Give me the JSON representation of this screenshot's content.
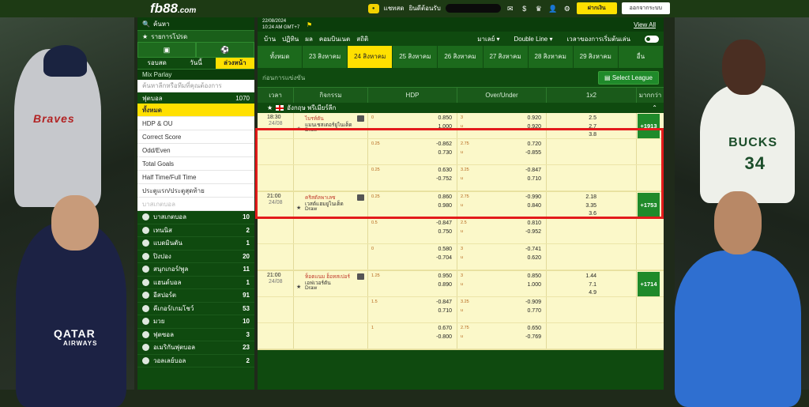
{
  "header": {
    "logo_main": "fb88",
    "logo_suffix": ".com",
    "chat_label": "แชทสด",
    "balance_label": "ยินดีต้อนรับ",
    "deposit_label": "ฝากเงิน",
    "logout_label": "ออกจากระบบ"
  },
  "background_text": {
    "braves": "Braves",
    "bucks": "BUCKS",
    "bucks_number": "34",
    "qatar": "QATAR",
    "airways": "AIRWAYS"
  },
  "sidebar": {
    "search_label": "ค้นหา",
    "list_title": "รายการโปรด",
    "day_tabs": [
      "รอบสด",
      "วันนี้",
      "ล่วงหน้า"
    ],
    "mix_parlay": "Mix Parlay",
    "search_placeholder": "ค้นหาลีกหรือทีมที่คุณต้องการ",
    "football_label": "ฟุตบอล",
    "football_count": "1070",
    "bet_types": [
      "ทั้งหมด",
      "HDP & OU",
      "Correct Score",
      "Odd/Even",
      "Total Goals",
      "Half Time/Full Time",
      "ประตูแรก/ประตูสุดท้าย",
      "บาสเกตบอล"
    ],
    "sports": [
      {
        "name": "บาสเกตบอล",
        "count": "10"
      },
      {
        "name": "เทนนิส",
        "count": "2"
      },
      {
        "name": "แบดมินตัน",
        "count": "1"
      },
      {
        "name": "ปิงปอง",
        "count": "20"
      },
      {
        "name": "สนุกเกอร์/พูล",
        "count": "11"
      },
      {
        "name": "แฮนด์บอล",
        "count": "1"
      },
      {
        "name": "อีสปอร์ต",
        "count": "91"
      },
      {
        "name": "คีเกอร์/เกมโชว์",
        "count": "53"
      },
      {
        "name": "มวย",
        "count": "10"
      },
      {
        "name": "ฟุตซอล",
        "count": "3"
      },
      {
        "name": "อเมริกันฟุตบอล",
        "count": "23"
      },
      {
        "name": "วอลเลย์บอล",
        "count": "2"
      }
    ]
  },
  "main": {
    "date_line1": "22/08/2024",
    "date_line2": "10:24 AM GMT+7",
    "view_all": "View All",
    "filters": [
      "บ้าน",
      "ปฏิทิน",
      "ผล",
      "คอมบินเนต",
      "สถิติ"
    ],
    "market_select": "มาเลย์",
    "line_select": "Double Line",
    "sort_label": "เวลาของการเริ่มต้นเล่น",
    "date_tabs": [
      "ทั้งหมด",
      "23 สิงหาคม",
      "24 สิงหาคม",
      "25 สิงหาคม",
      "26 สิงหาคม",
      "27 สิงหาคม",
      "28 สิงหาคม",
      "29 สิงหาคม",
      "อื่น"
    ],
    "league_filter_label": "ก่อนการแข่งขัน",
    "select_league": "Select League",
    "columns": [
      "เวลา",
      "กิจกรรม",
      "HDP",
      "Over/Under",
      "1x2",
      "มากกว่า"
    ],
    "league_name": "อังกฤษ พรีเมียร์ลีก"
  },
  "matches": [
    {
      "time": "18:30",
      "date": "24/08",
      "home": "ไบรท์ตัน",
      "away": "แมนเชสเตอร์ยูไนเต็ด",
      "draw": "Draw",
      "rows": [
        {
          "hdp_line": "0",
          "hdp_home": "0.850",
          "hdp_away": "1.000",
          "ou_line": "3",
          "ou_over": "0.920",
          "ou_under": "0.920",
          "x1": "2.5",
          "x2": "2.7",
          "x3": "3.8"
        },
        {
          "hdp_line": "0.25",
          "hdp_home": "-0.862",
          "hdp_away": "0.730",
          "ou_line": "2.75",
          "ou_over": "0.720",
          "ou_under": "-0.855",
          "x1": "",
          "x2": "",
          "x3": ""
        },
        {
          "hdp_line": "0.25",
          "hdp_home": "0.630",
          "hdp_away": "-0.752",
          "ou_line": "3.25",
          "ou_over": "-0.847",
          "ou_under": "0.710",
          "x1": "",
          "x2": "",
          "x3": ""
        }
      ],
      "more": "+1913"
    },
    {
      "time": "21:00",
      "date": "24/08",
      "home": "คริสตัลพาเลซ",
      "away": "เวสต์แฮมยูไนเต็ด",
      "draw": "Draw",
      "rows": [
        {
          "hdp_line": "0.25",
          "hdp_home": "0.860",
          "hdp_away": "0.980",
          "ou_line": "2.75",
          "ou_over": "-0.990",
          "ou_under": "0.840",
          "x1": "2.18",
          "x2": "3.35",
          "x3": "3.6"
        },
        {
          "hdp_line": "0.5",
          "hdp_home": "-0.847",
          "hdp_away": "0.750",
          "ou_line": "2.5",
          "ou_over": "0.810",
          "ou_under": "-0.952",
          "x1": "",
          "x2": "",
          "x3": ""
        },
        {
          "hdp_line": "0",
          "hdp_home": "0.580",
          "hdp_away": "-0.704",
          "ou_line": "3",
          "ou_over": "-0.741",
          "ou_under": "0.620",
          "x1": "",
          "x2": "",
          "x3": ""
        }
      ],
      "more": "+1753"
    },
    {
      "time": "21:00",
      "date": "24/08",
      "home": "ท็อตแนม ฮ็อทสเปอร์",
      "away": "เอฟเวอร์ตัน",
      "draw": "Draw",
      "rows": [
        {
          "hdp_line": "1.25",
          "hdp_home": "0.950",
          "hdp_away": "0.890",
          "ou_line": "3",
          "ou_over": "0.850",
          "ou_under": "1.000",
          "x1": "1.44",
          "x2": "7.1",
          "x3": "4.9"
        },
        {
          "hdp_line": "1.5",
          "hdp_home": "-0.847",
          "hdp_away": "0.710",
          "ou_line": "3.25",
          "ou_over": "-0.909",
          "ou_under": "0.770",
          "x1": "",
          "x2": "",
          "x3": ""
        },
        {
          "hdp_line": "1",
          "hdp_home": "0.670",
          "hdp_away": "-0.800",
          "ou_line": "2.75",
          "ou_over": "0.650",
          "ou_under": "-0.769",
          "x1": "",
          "x2": "",
          "x3": ""
        }
      ],
      "more": "+1714"
    }
  ]
}
